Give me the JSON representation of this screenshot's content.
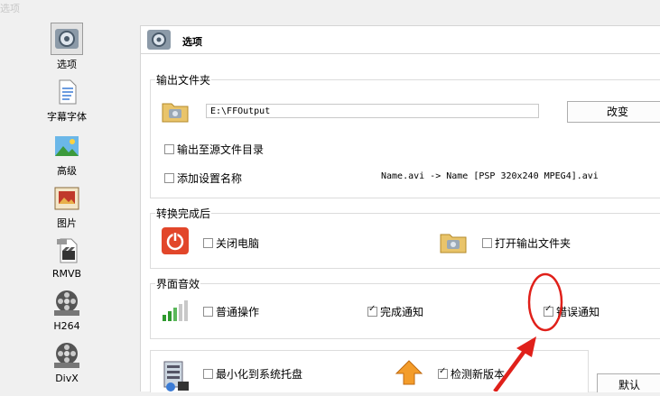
{
  "window": {
    "title": "选项"
  },
  "sidebar": {
    "items": [
      {
        "label": "选项"
      },
      {
        "label": "字幕字体"
      },
      {
        "label": "高级"
      },
      {
        "label": "图片"
      },
      {
        "label": "RMVB"
      },
      {
        "label": "H264"
      },
      {
        "label": "DivX"
      }
    ]
  },
  "header": {
    "title": "选项"
  },
  "output_folder": {
    "title": "输出文件夹",
    "path": "E:\\FFOutput",
    "change_label": "改变",
    "output_to_source": {
      "label": "输出至源文件目录",
      "checked": false
    },
    "add_setting_name": {
      "label": "添加设置名称",
      "checked": false
    },
    "name_preview": "Name.avi  -> Name [PSP 320x240 MPEG4].avi"
  },
  "after_convert": {
    "title": "转换完成后",
    "shutdown": {
      "label": "关闭电脑",
      "checked": false
    },
    "open_folder": {
      "label": "打开输出文件夹",
      "checked": false
    }
  },
  "sound": {
    "title": "界面音效",
    "normal": {
      "label": "普通操作",
      "checked": false
    },
    "complete": {
      "label": "完成通知",
      "checked": true
    },
    "error": {
      "label": "错误通知",
      "checked": true
    }
  },
  "misc": {
    "minimize_tray": {
      "label": "最小化到系统托盘",
      "checked": false
    },
    "check_update": {
      "label": "检测新版本",
      "checked": true
    },
    "default_label": "默认"
  },
  "colors": {
    "annotation": "#e0201a",
    "shutdown_icon": "#e2462a"
  }
}
